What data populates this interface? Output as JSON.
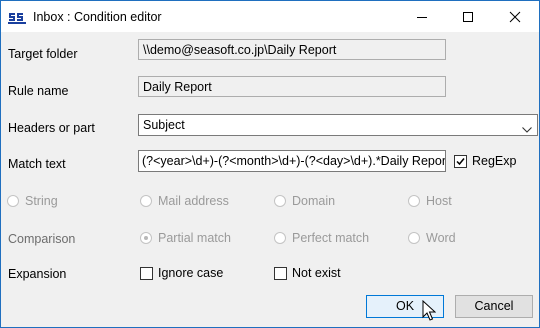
{
  "window": {
    "title": "Inbox : Condition editor",
    "accent": "#0078d7"
  },
  "title_bar_controls": [
    "minimize-icon",
    "maximize-icon",
    "close-icon"
  ],
  "fields": {
    "target_folder": {
      "label": "Target folder",
      "value": "\\\\demo@seasoft.co.jp\\Daily Report"
    },
    "rule_name": {
      "label": "Rule name",
      "value": "Daily Report"
    },
    "headers": {
      "label": "Headers or part",
      "value": "Subject"
    },
    "match_text": {
      "label": "Match text",
      "value": "(?<year>\\d+)-(?<month>\\d+)-(?<day>\\d+).*Daily Report"
    }
  },
  "regexp": {
    "label": "RegExp",
    "checked": true
  },
  "match_type": {
    "options": [
      "String",
      "Mail address",
      "Domain",
      "Host"
    ],
    "enabled": false
  },
  "comparison": {
    "label": "Comparison",
    "options": [
      "Partial match",
      "Perfect match",
      "Word"
    ],
    "selected": "Partial match",
    "enabled": false
  },
  "expansion": {
    "label": "Expansion",
    "ignore_case": {
      "label": "Ignore case",
      "checked": false
    },
    "not_exist": {
      "label": "Not exist",
      "checked": false
    }
  },
  "buttons": {
    "ok": "OK",
    "cancel": "Cancel"
  }
}
